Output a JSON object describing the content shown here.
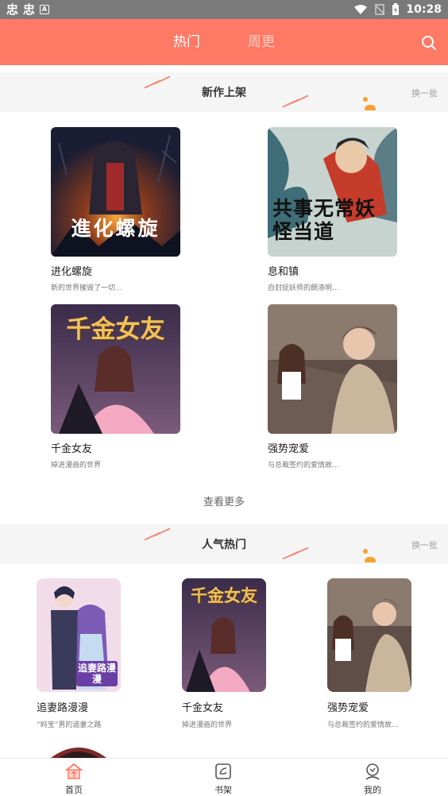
{
  "status_bar": {
    "time": "10:28",
    "left_icons": [
      "忠",
      "忠",
      "A"
    ]
  },
  "header": {
    "tabs": [
      "热门",
      "周更"
    ],
    "active_tab": "热门"
  },
  "section_new": {
    "title": "新作上架",
    "refresh_label": "换一批",
    "items": [
      {
        "name": "进化螺旋",
        "desc": "新的世界摧毁了一切...",
        "cover_text": "進化螺旋"
      },
      {
        "name": "息和镇",
        "desc": "自封捉妖师的朗涤明...",
        "cover_text": "共事无常妖怪当道"
      },
      {
        "name": "千金女友",
        "desc": "掉进漫画的世界",
        "cover_text": "千金女友"
      },
      {
        "name": "强势宠爱",
        "desc": "与总裁签约的爱情故..."
      }
    ],
    "see_more_label": "查看更多"
  },
  "section_hot": {
    "title": "人气热门",
    "refresh_label": "换一批",
    "items": [
      {
        "name": "追妻路漫漫",
        "desc": "“妈宝”男的追妻之路",
        "cover_text": "追妻路漫漫"
      },
      {
        "name": "千金女友",
        "desc": "掉进漫画的世界",
        "cover_text": "千金女友"
      },
      {
        "name": "强势宠爱",
        "desc": "与总裁签约的爱情故..."
      }
    ]
  },
  "bottom_nav": {
    "items": [
      {
        "label": "首页",
        "icon": "home-icon"
      },
      {
        "label": "书架",
        "icon": "bookshelf-icon"
      },
      {
        "label": "我的",
        "icon": "profile-icon"
      }
    ]
  },
  "colors": {
    "accent": "#fe7a65",
    "section_bg": "#f5f5f5",
    "decor_orange": "#f6a231"
  }
}
